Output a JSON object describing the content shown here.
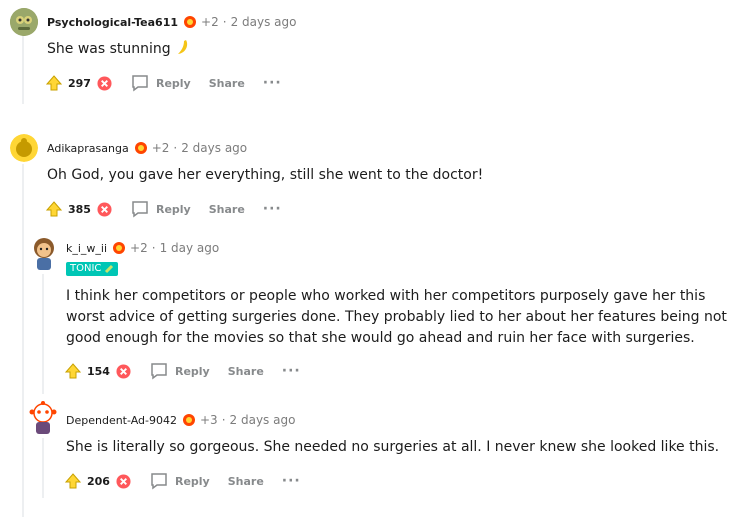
{
  "comments": [
    {
      "username": "Psychological-Tea611",
      "award_count": "+2",
      "time": "2 days ago",
      "text": "She was stunning",
      "score": "297",
      "reply": "Reply",
      "share": "Share"
    },
    {
      "username": "Adikaprasanga",
      "award_count": "+2",
      "time": "2 days ago",
      "text": "Oh God, you gave her everything, still she went to the doctor!",
      "score": "385",
      "reply": "Reply",
      "share": "Share"
    },
    {
      "username": "k_i_w_ii",
      "award_count": "+2",
      "time": "1 day ago",
      "flair": "TONIC",
      "text_lines": [
        "I think her competitors or people who worked with her competitors purposely gave her this",
        "worst advice of getting surgeries done. They probably lied to her about her features being not",
        "good enough for the movies so that she would go ahead and ruin her face with surgeries."
      ],
      "score": "154",
      "reply": "Reply",
      "share": "Share"
    },
    {
      "username": "Dependent-Ad-9042",
      "award_count": "+3",
      "time": "2 days ago",
      "text": "She is literally so gorgeous. She needed no surgeries at all. I never knew she looked like this.",
      "score": "206",
      "reply": "Reply",
      "share": "Share"
    }
  ],
  "separator": "·",
  "more": "···",
  "colors": {
    "flair_bg": "#00c6b5",
    "meta": "#7c7c7c",
    "action": "#878a8c",
    "thread_line": "#edeff1"
  },
  "icons": [
    "upvote-icon",
    "downvote-icon",
    "comment-icon",
    "award-icon",
    "banana-emoji"
  ]
}
